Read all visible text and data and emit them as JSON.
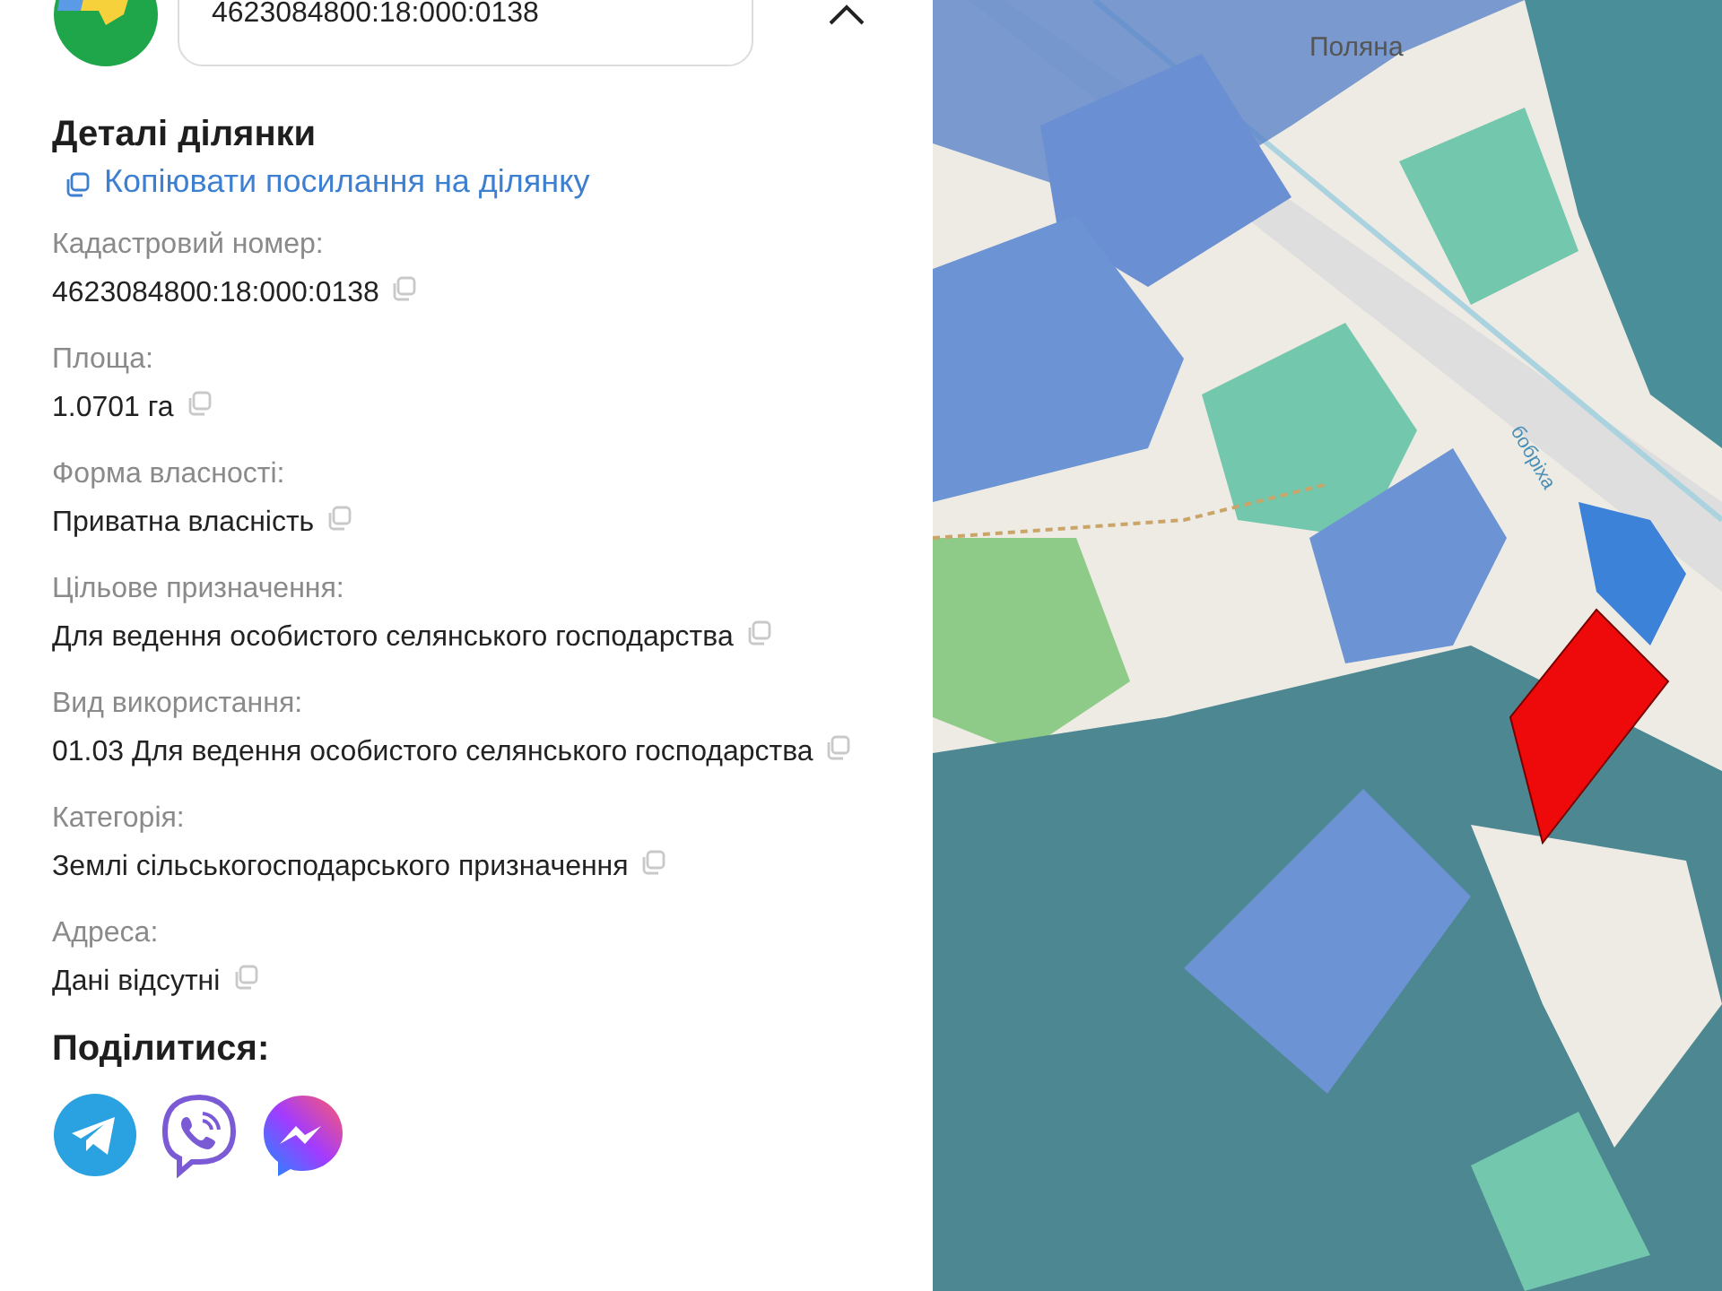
{
  "search": {
    "value": "4623084800:18:000:0138"
  },
  "details": {
    "title": "Деталі ділянки",
    "copy_link": "Копіювати посилання на ділянку",
    "fields": [
      {
        "label": "Кадастровий номер:",
        "value": "4623084800:18:000:0138"
      },
      {
        "label": "Площа:",
        "value": "1.0701 га"
      },
      {
        "label": "Форма власності:",
        "value": "Приватна власність"
      },
      {
        "label": "Цільове призначення:",
        "value": "Для ведення особистого селянського господарства"
      },
      {
        "label": "Вид використання:",
        "value": "01.03 Для ведення особистого селянського господарства"
      },
      {
        "label": "Категорія:",
        "value": "Землі сільськогосподарського призначення"
      },
      {
        "label": "Адреса:",
        "value": "Дані відсутні"
      }
    ]
  },
  "share": {
    "title": "Поділитися:",
    "buttons": [
      {
        "kind": "telegram"
      },
      {
        "kind": "viber"
      },
      {
        "kind": "messenger"
      }
    ]
  },
  "map": {
    "labels": [
      {
        "kind": "place",
        "text": "Поляна"
      },
      {
        "kind": "river",
        "text": "бобріха"
      }
    ]
  }
}
